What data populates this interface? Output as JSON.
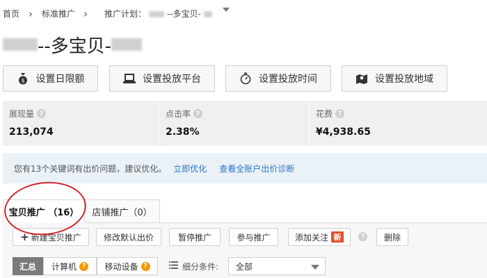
{
  "breadcrumb": {
    "home": "首页",
    "standard": "标准推广",
    "plan_label": "推广计划：",
    "plan_name": "--多宝贝-"
  },
  "title": {
    "text": "--多宝贝-"
  },
  "actions": [
    {
      "label": "设置日限额",
      "icon": "money-bag-icon"
    },
    {
      "label": "设置投放平台",
      "icon": "laptop-icon"
    },
    {
      "label": "设置投放时间",
      "icon": "stopwatch-icon"
    },
    {
      "label": "设置投放地域",
      "icon": "map-pin-icon"
    }
  ],
  "stats": [
    {
      "label": "展现量",
      "value": "213,074"
    },
    {
      "label": "点击率",
      "value": "2.38%"
    },
    {
      "label": "花费",
      "value": "¥4,938.65"
    }
  ],
  "notice": {
    "text": "您有13个关键词有出价问题，建议优化。",
    "link1": "立即优化",
    "link2": "查看全账户出价诊断"
  },
  "tabs": [
    {
      "label": "宝贝推广 （16）",
      "active": true
    },
    {
      "label": "店铺推广（0）",
      "active": false
    }
  ],
  "toolbar": {
    "new_promo": "新建宝贝推广",
    "modify_bid": "修改默认出价",
    "pause": "暂停推广",
    "join": "参与推广",
    "add_follow": "添加关注",
    "new_badge": "新",
    "delete": "删除"
  },
  "segments": [
    {
      "label": "汇总",
      "active": true
    },
    {
      "label": "计算机",
      "active": false
    },
    {
      "label": "移动设备",
      "active": false
    }
  ],
  "filter": {
    "label": "细分条件:",
    "value": "全部"
  }
}
